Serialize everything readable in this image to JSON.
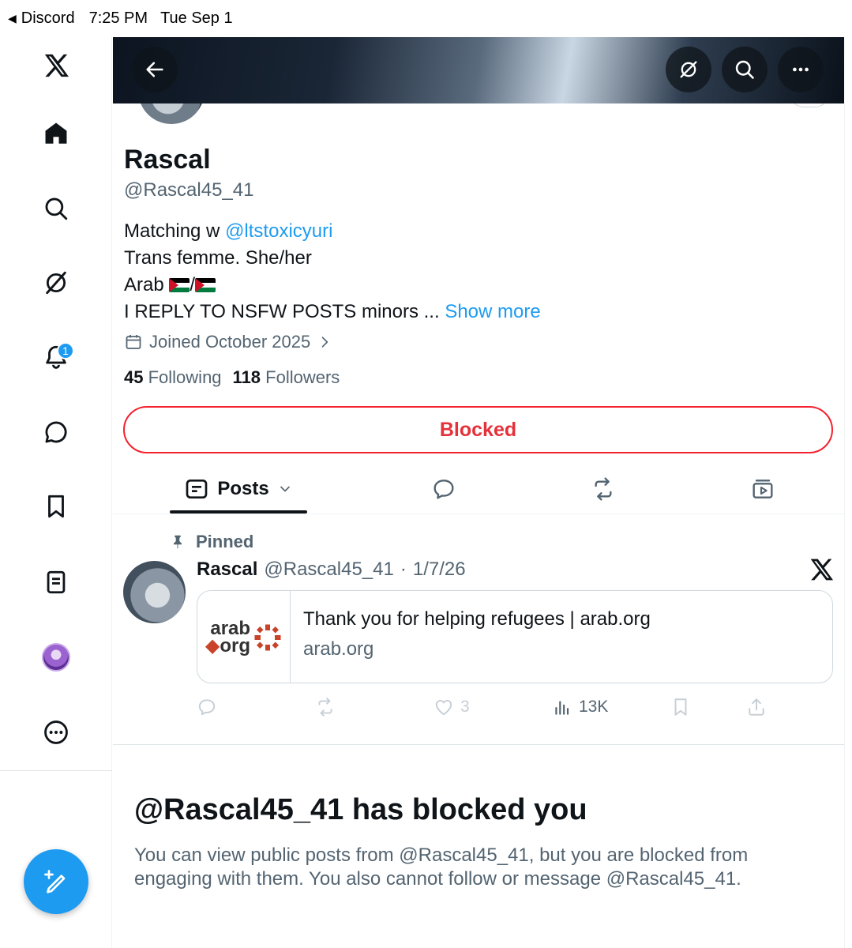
{
  "status_bar": {
    "back_app": "Discord",
    "time": "7:25 PM",
    "date": "Tue Sep 1"
  },
  "nav": {
    "logo": "x-logo-icon",
    "items": [
      "home-icon",
      "search-icon",
      "grok-icon",
      "notifications-icon",
      "messages-icon",
      "bookmarks-icon",
      "lists-icon",
      "profile-avatar",
      "more-icon"
    ],
    "notification_count": "1",
    "compose": "compose-icon"
  },
  "header": {
    "back": "back-arrow-icon",
    "actions": [
      "grok-icon",
      "search-icon",
      "more-icon"
    ]
  },
  "profile": {
    "name": "Rascal",
    "handle": "@Rascal45_41",
    "bio": {
      "line1_prefix": "Matching w ",
      "line1_mention": "@ltstoxicyuri",
      "line2": "Trans femme. She/her",
      "line3_prefix": "Arab ",
      "line3_sep": "/",
      "line4": "I REPLY TO NSFW POSTS minors ... ",
      "show_more": "Show more"
    },
    "joined": "Joined October 2025",
    "following_count": "45",
    "following_label": "Following",
    "followers_count": "118",
    "followers_label": "Followers",
    "blocked_button": "Blocked"
  },
  "tabs": {
    "posts_label": "Posts"
  },
  "post": {
    "pinned_label": "Pinned",
    "author_name": "Rascal",
    "author_handle": "@Rascal45_41",
    "separator": "·",
    "date": "1/7/26",
    "card": {
      "logo_top": "arab",
      "logo_bottom": "org",
      "title": "Thank you for helping refugees | arab.org",
      "domain": "arab.org"
    },
    "likes": "3",
    "views": "13K"
  },
  "blocked_notice": {
    "title": "@Rascal45_41 has blocked you",
    "text": "You can view public posts from @Rascal45_41, but you are blocked from engaging with them. You also cannot follow or message @Rascal45_41."
  },
  "colors": {
    "accent": "#1d9bf0",
    "blocked_red": "#f4212e",
    "secondary_text": "#536471"
  }
}
